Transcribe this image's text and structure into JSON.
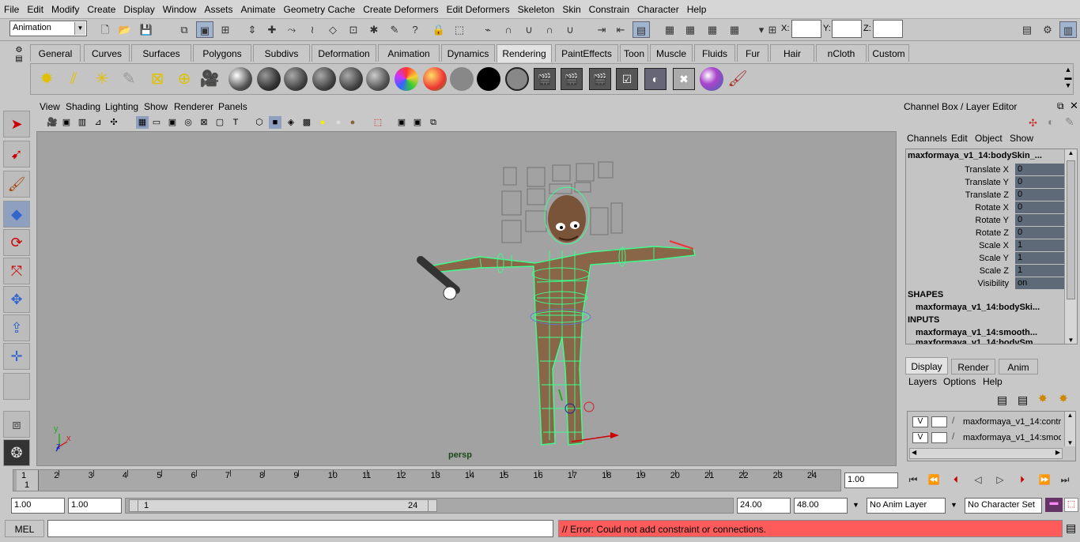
{
  "menu": [
    "File",
    "Edit",
    "Modify",
    "Create",
    "Display",
    "Window",
    "Assets",
    "Animate",
    "Geometry Cache",
    "Create Deformers",
    "Edit Deformers",
    "Skeleton",
    "Skin",
    "Constrain",
    "Character",
    "Help"
  ],
  "status": {
    "mode": "Animation",
    "x_label": "X:",
    "y_label": "Y:",
    "z_label": "Z:"
  },
  "shelf_tabs": [
    "General",
    "Curves",
    "Surfaces",
    "Polygons",
    "Subdivs",
    "Deformation",
    "Animation",
    "Dynamics",
    "Rendering",
    "PaintEffects",
    "Toon",
    "Muscle",
    "Fluids",
    "Fur",
    "Hair",
    "nCloth",
    "Custom"
  ],
  "panel_menu": [
    "View",
    "Shading",
    "Lighting",
    "Show",
    "Renderer",
    "Panels"
  ],
  "viewport": {
    "camera_label": "persp",
    "axis_x": "x",
    "axis_y": "y",
    "axis_z": "z"
  },
  "channel_box": {
    "title": "Channel Box / Layer Editor",
    "menus": [
      "Channels",
      "Edit",
      "Object",
      "Show"
    ],
    "object_name": "maxformaya_v1_14:bodySkin_...",
    "channels": [
      {
        "label": "Translate X",
        "value": "0"
      },
      {
        "label": "Translate Y",
        "value": "0"
      },
      {
        "label": "Translate Z",
        "value": "0"
      },
      {
        "label": "Rotate X",
        "value": "0"
      },
      {
        "label": "Rotate Y",
        "value": "0"
      },
      {
        "label": "Rotate Z",
        "value": "0"
      },
      {
        "label": "Scale X",
        "value": "1"
      },
      {
        "label": "Scale Y",
        "value": "1"
      },
      {
        "label": "Scale Z",
        "value": "1"
      },
      {
        "label": "Visibility",
        "value": "on"
      }
    ],
    "shapes_header": "SHAPES",
    "shapes_item": "maxformaya_v1_14:bodySki...",
    "inputs_header": "INPUTS",
    "inputs_item": "maxformaya_v1_14:smooth...",
    "inputs_item2": "maxformaya_v1_14:bodySm..."
  },
  "layer_editor": {
    "tabs": [
      "Display",
      "Render",
      "Anim"
    ],
    "menus": [
      "Layers",
      "Options",
      "Help"
    ],
    "layers": [
      {
        "v": "V",
        "name": "maxformaya_v1_14:contr"
      },
      {
        "v": "V",
        "name": "maxformaya_v1_14:smoo"
      }
    ]
  },
  "timeline": {
    "ticks": [
      "1",
      "2",
      "3",
      "4",
      "5",
      "6",
      "7",
      "8",
      "9",
      "10",
      "11",
      "12",
      "13",
      "14",
      "15",
      "16",
      "17",
      "18",
      "19",
      "20",
      "21",
      "22",
      "23",
      "24"
    ],
    "current_frame_marker": "1",
    "current_time": "1.00"
  },
  "range": {
    "start_time": "1.00",
    "playback_start": "1.00",
    "range_start": "1",
    "range_end": "24",
    "playback_end": "24.00",
    "end_time": "48.00",
    "anim_layer": "No Anim Layer",
    "character_set": "No Character Set"
  },
  "command": {
    "lang": "MEL",
    "error": "// Error: Could not add constraint or connections."
  },
  "colors": {
    "error_bg": "#ff5b5b",
    "viewport_bg": "#a2a2a2",
    "wire": "#3cff8c",
    "skin": "#8a6648"
  }
}
